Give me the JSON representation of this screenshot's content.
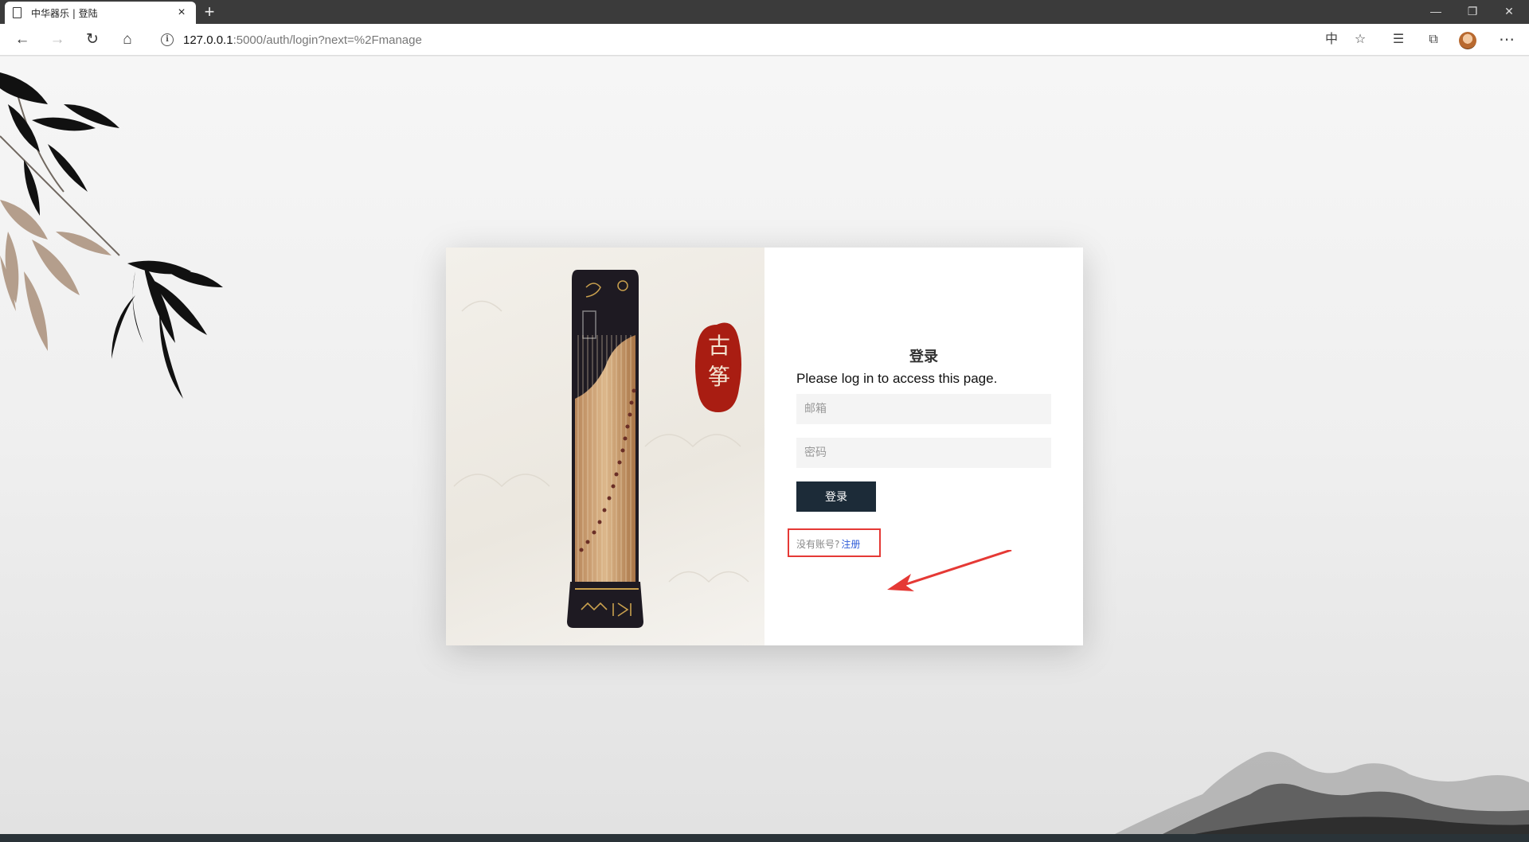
{
  "browser": {
    "tab_title": "中华器乐 | 登陆",
    "tab_close": "×",
    "new_tab": "+",
    "url_host": "127.0.0.1",
    "url_rest": ":5000/auth/login?next=%2Fmanage"
  },
  "card": {
    "stamp_chars": [
      "古",
      "筝"
    ]
  },
  "form": {
    "title": "登录",
    "message": "Please log in to access this page.",
    "email_placeholder": "邮箱",
    "password_placeholder": "密码",
    "submit_label": "登录",
    "no_account_text": "没有账号?",
    "register_link": "注册"
  },
  "annotation": {
    "color": "#e53935"
  }
}
